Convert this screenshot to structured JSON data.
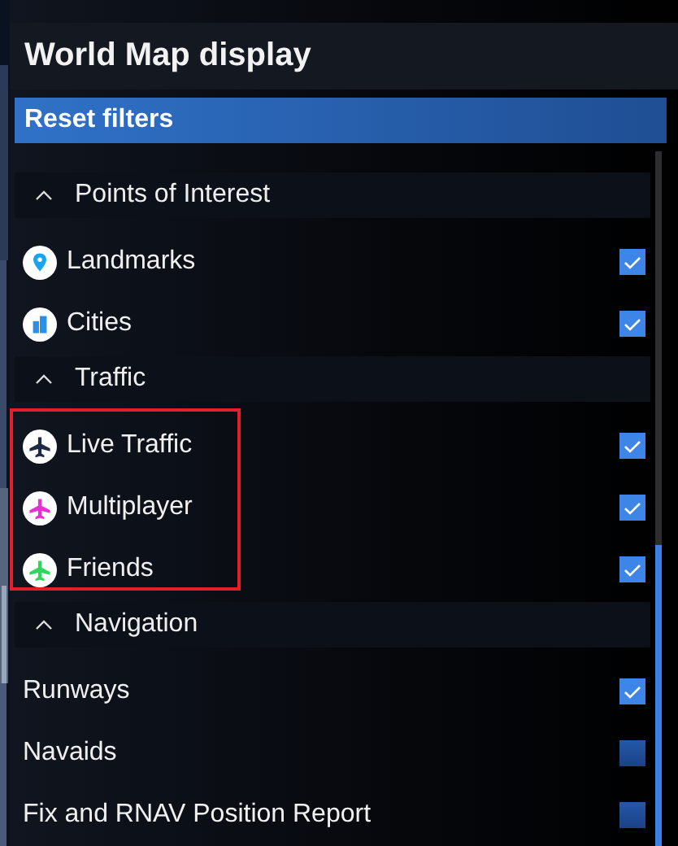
{
  "window": {
    "title": "World Map display"
  },
  "reset_button": {
    "label": "Reset filters"
  },
  "sections": [
    {
      "title": "Points of Interest",
      "expanded": true,
      "highlighted": false,
      "items": [
        {
          "kind": "pin",
          "label": "Landmarks",
          "color": "#1aa3f0",
          "checked": true
        },
        {
          "kind": "city",
          "label": "Cities",
          "color": "#2a8fe8",
          "checked": true
        }
      ]
    },
    {
      "title": "Traffic",
      "expanded": true,
      "highlighted": true,
      "items": [
        {
          "kind": "plane",
          "label": "Live Traffic",
          "color": "#1c2a44",
          "checked": true
        },
        {
          "kind": "plane",
          "label": "Multiplayer",
          "color": "#e82fd6",
          "checked": true
        },
        {
          "kind": "plane",
          "label": "Friends",
          "color": "#2ed65a",
          "checked": true
        }
      ]
    },
    {
      "title": "Navigation",
      "expanded": true,
      "highlighted": false,
      "items": [
        {
          "kind": "plain",
          "label": "Runways",
          "checked": true
        },
        {
          "kind": "plain",
          "label": "Navaids",
          "checked": false
        },
        {
          "kind": "plain",
          "label": "Fix and RNAV Position Report",
          "checked": false
        }
      ]
    }
  ]
}
